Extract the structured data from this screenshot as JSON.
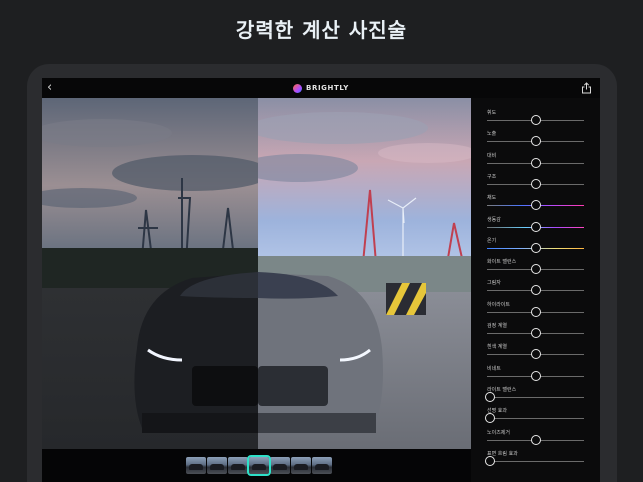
{
  "headline": "강력한 계산 사진술",
  "app": {
    "brand": "BRIGHTLY",
    "back_glyph": "‹"
  },
  "adjustments": [
    {
      "label": "휘도",
      "value": 0.5,
      "track": "plain"
    },
    {
      "label": "노출",
      "value": 0.5,
      "track": "plain"
    },
    {
      "label": "대비",
      "value": 0.5,
      "track": "plain"
    },
    {
      "label": "구조",
      "value": 0.5,
      "track": "plain"
    },
    {
      "label": "채도",
      "value": 0.5,
      "track": "saturation"
    },
    {
      "label": "생동감",
      "value": 0.5,
      "track": "vibrance"
    },
    {
      "label": "온기",
      "value": 0.5,
      "track": "warmth"
    },
    {
      "label": "화이트 밸런스",
      "value": 0.5,
      "track": "plain"
    },
    {
      "label": "그림자",
      "value": 0.5,
      "track": "plain"
    },
    {
      "label": "하이라이트",
      "value": 0.5,
      "track": "plain"
    },
    {
      "label": "검정 계열",
      "value": 0.5,
      "track": "plain"
    },
    {
      "label": "흰색 계열",
      "value": 0.5,
      "track": "plain"
    },
    {
      "label": "비네트",
      "value": 0.5,
      "track": "plain"
    },
    {
      "label": "라이트 밸런스",
      "value": 0.0,
      "track": "plain"
    },
    {
      "label": "선명 효과",
      "value": 0.0,
      "track": "plain"
    },
    {
      "label": "노이즈제거",
      "value": 0.5,
      "track": "plain"
    },
    {
      "label": "표면 흐림 효과",
      "value": 0.0,
      "track": "plain"
    }
  ],
  "filmstrip": {
    "count": 7,
    "active_index": 3
  },
  "colors": {
    "accent": "#2ee0c8",
    "background": "#1e1f21",
    "panel": "#0b0b0c"
  },
  "icons": {
    "back": "chevron-left-icon",
    "share": "share-icon",
    "logo": "brightly-logo-icon"
  }
}
